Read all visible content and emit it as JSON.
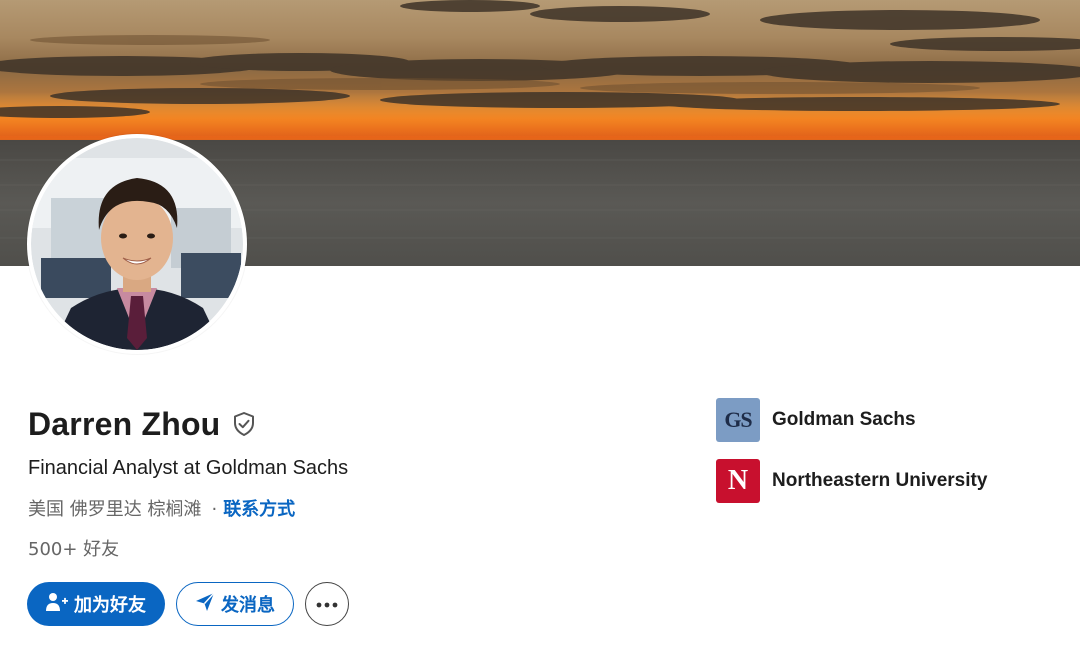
{
  "profile": {
    "name": "Darren Zhou",
    "headline": "Financial Analyst at Goldman Sachs",
    "location": "美国 佛罗里达 棕榈滩",
    "separator": "·",
    "contact_info_label": "联系方式",
    "connections": "500+ 好友"
  },
  "actions": {
    "connect_label": "加为好友",
    "message_label": "发消息",
    "more_icon": "ellipsis-icon"
  },
  "organizations": [
    {
      "name": "Goldman Sachs",
      "logo_text": "GS",
      "logo_color": "#7c9cc4"
    },
    {
      "name": "Northeastern University",
      "logo_text": "N",
      "logo_color": "#c8102e"
    }
  ],
  "colors": {
    "accent": "#0a66c2",
    "text_primary": "#1d1d1d",
    "text_secondary": "#666666"
  },
  "icons": {
    "verified": "shield-check-icon",
    "connect": "add-person-icon",
    "message": "send-icon"
  }
}
